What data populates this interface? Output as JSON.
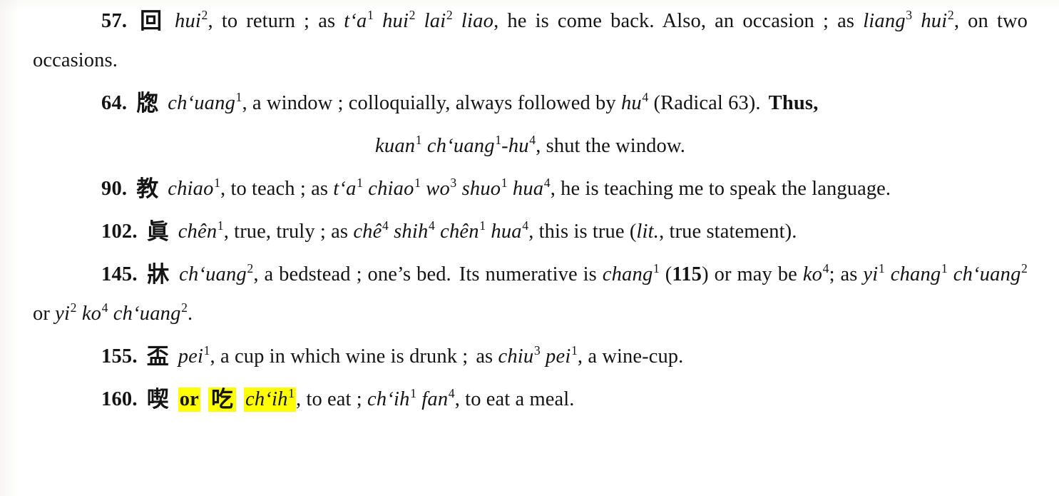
{
  "page": {
    "kind": "scanned-dictionary-page",
    "background_color": "#ffffff",
    "text_color": "#141414",
    "highlight_color": "#ffff00"
  },
  "entries": [
    {
      "number": "57.",
      "character": "回",
      "reading": "hui",
      "tone": "2",
      "definition_parts": {
        "p1": ", to return ; as ",
        "rom_a": "t‘a",
        "tone_a": "1",
        "rom_b": "hui",
        "tone_b": "2",
        "rom_c": "lai",
        "tone_c": "2",
        "rom_d": "liao",
        "p2": ", he is come back.",
        "p3": "Also, an occasion ; as ",
        "rom_e": "liang",
        "tone_e": "3",
        "rom_f": "hui",
        "tone_f": "2",
        "p4": ", on two occasions."
      }
    },
    {
      "number": "64.",
      "character": "牎",
      "reading": "ch‘uang",
      "tone": "1",
      "definition_parts": {
        "p1": ", a window ; colloquially, always followed by ",
        "rom_a": "hu",
        "tone_a": "4",
        "p2": " (Radical 63).",
        "p3": "Thus,"
      },
      "example_line": {
        "rom_a": "kuan",
        "tone_a": "1",
        "rom_b": "ch‘uang",
        "tone_b": "1",
        "sep": "-",
        "rom_c": "hu",
        "tone_c": "4",
        "tail": ", shut the window."
      }
    },
    {
      "number": "90.",
      "character": "教",
      "reading": "chiao",
      "tone": "1",
      "definition_parts": {
        "p1": ", to teach ; as ",
        "rom_a": "t‘a",
        "tone_a": "1",
        "rom_b": "chiao",
        "tone_b": "1",
        "rom_c": "wo",
        "tone_c": "3",
        "rom_d": "shuo",
        "tone_d": "1",
        "rom_e": "hua",
        "tone_e": "4",
        "p2": ", he is teaching me to speak the language."
      }
    },
    {
      "number": "102.",
      "character": "眞",
      "reading": "chên",
      "tone": "1",
      "definition_parts": {
        "p1": ", true, truly ; as ",
        "rom_a": "chê",
        "tone_a": "4",
        "rom_b": "shih",
        "tone_b": "4",
        "rom_c": "chên",
        "tone_c": "1",
        "rom_d": "hua",
        "tone_d": "4",
        "p2": ", this is true (",
        "lit": "lit.",
        "p3": ", true statement)."
      }
    },
    {
      "number": "145.",
      "character": "牀",
      "reading": "ch‘uang",
      "tone": "2",
      "definition_parts": {
        "p1": ", a bedstead ; one’s bed.",
        "p2": "Its numerative is ",
        "rom_a": "chang",
        "tone_a": "1",
        "p3": " (",
        "bold_ref": "115",
        "p4": ") or may be ",
        "rom_b": "ko",
        "tone_b": "4",
        "p5": "; as ",
        "rom_c": "yi",
        "tone_c": "1",
        "rom_d": "chang",
        "tone_d": "1",
        "rom_e": "ch‘uang",
        "tone_e": "2",
        "p6": " or ",
        "rom_f": "yi",
        "tone_f": "2",
        "rom_g": "ko",
        "tone_g": "4",
        "rom_h": "ch‘uang",
        "tone_h": "2",
        "p7": "."
      }
    },
    {
      "number": "155.",
      "character": "盃",
      "reading": "pei",
      "tone": "1",
      "definition_parts": {
        "p1": ", a cup in which wine is drunk ;",
        "p2": "as ",
        "rom_a": "chiu",
        "tone_a": "3",
        "rom_b": "pei",
        "tone_b": "1",
        "p3": ", a wine-cup."
      }
    },
    {
      "number": "160.",
      "character": "喫",
      "or_word": "or",
      "character_alt": "吃",
      "reading": "ch‘ih",
      "tone": "1",
      "definition_parts": {
        "p1": ", to eat ; ",
        "rom_a": "ch‘ih",
        "tone_a": "1",
        "rom_b": "fan",
        "tone_b": "4",
        "p2": ", to eat a meal."
      },
      "highlighted": true
    }
  ]
}
